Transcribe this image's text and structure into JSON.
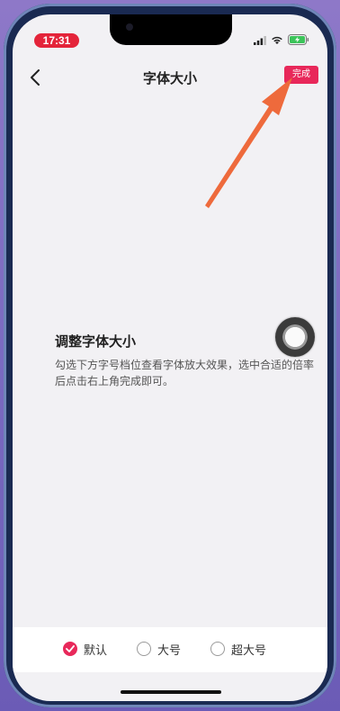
{
  "status_bar": {
    "time": "17:31"
  },
  "nav": {
    "title": "字体大小",
    "done_label": "完成"
  },
  "content": {
    "heading": "调整字体大小",
    "description": "勾选下方字号档位查看字体放大效果，选中合适的倍率后点击右上角完成即可。"
  },
  "font_options": [
    {
      "label": "默认",
      "selected": true
    },
    {
      "label": "大号",
      "selected": false
    },
    {
      "label": "超大号",
      "selected": false
    }
  ],
  "colors": {
    "accent": "#e8285a",
    "arrow": "#ee6a3c",
    "time_pill": "#e4243a"
  }
}
